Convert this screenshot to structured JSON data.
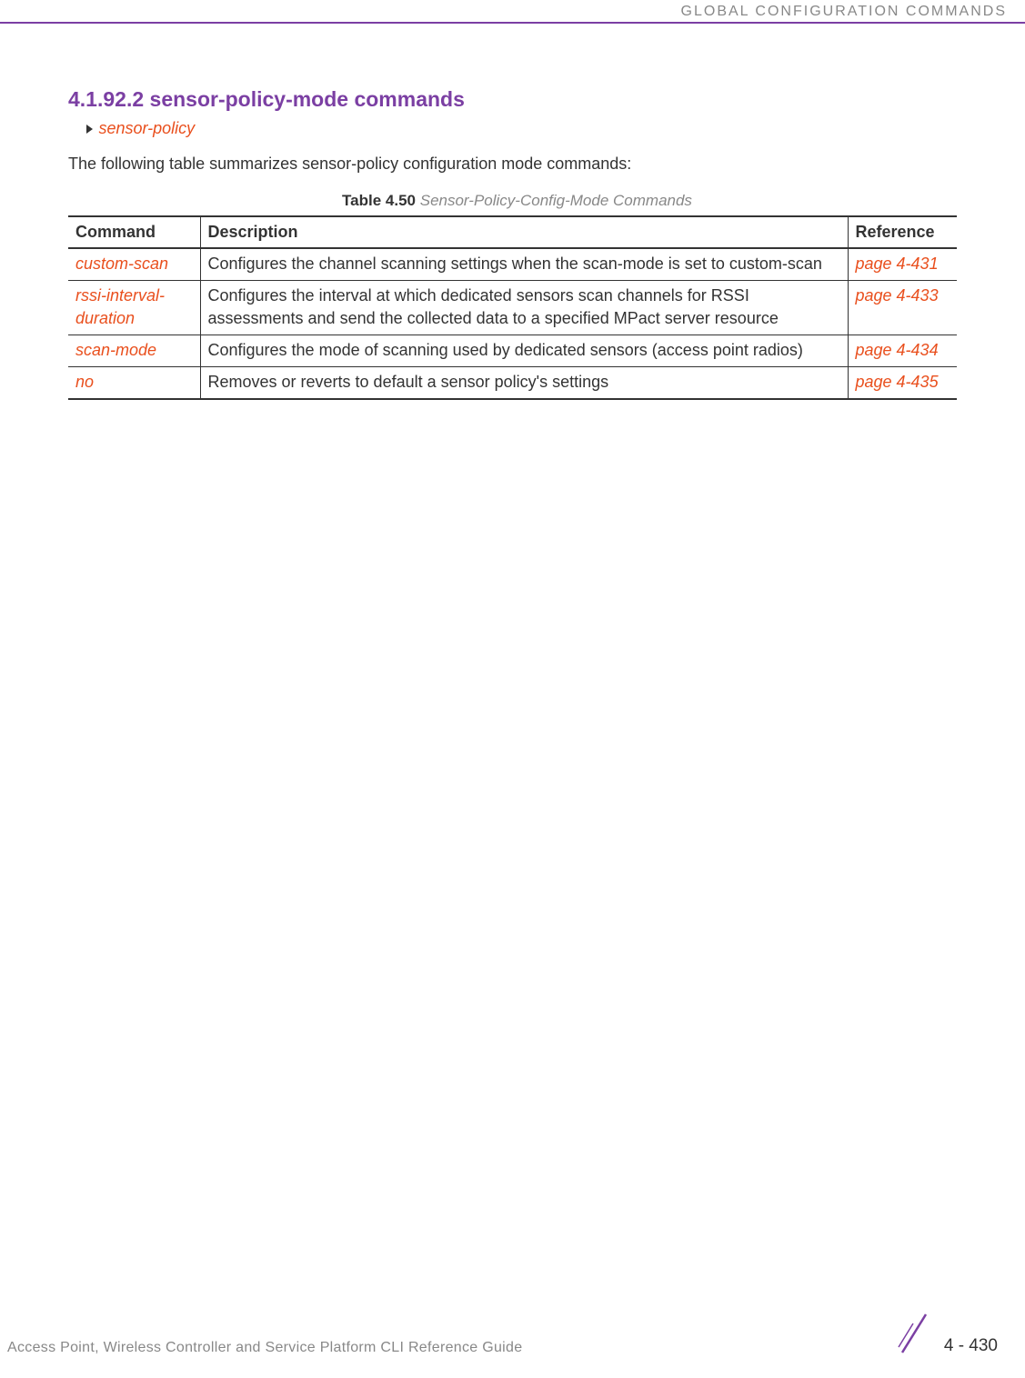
{
  "header": {
    "title": "GLOBAL CONFIGURATION COMMANDS"
  },
  "section": {
    "number": "4.1.92.2",
    "title": "sensor-policy-mode commands",
    "breadcrumb_link": "sensor-policy",
    "intro": "The following table summarizes sensor-policy configuration mode commands:"
  },
  "table": {
    "caption_prefix": "Table 4.50",
    "caption_title": " Sensor-Policy-Config-Mode Commands",
    "headers": {
      "command": "Command",
      "description": "Description",
      "reference": "Reference"
    },
    "rows": [
      {
        "command": "custom-scan",
        "description": "Configures the channel scanning settings when the scan-mode is set to custom-scan",
        "reference": "page 4-431"
      },
      {
        "command": "rssi-interval-duration",
        "description": "Configures the interval at which dedicated sensors scan channels for RSSI assessments and send the collected data to a specified MPact server resource",
        "reference": "page 4-433"
      },
      {
        "command": "scan-mode",
        "description": "Configures the mode of scanning used by dedicated sensors (access point radios)",
        "reference": "page 4-434"
      },
      {
        "command": "no",
        "description": "Removes or reverts to default a sensor policy's settings",
        "reference": "page 4-435"
      }
    ]
  },
  "footer": {
    "guide_title": "Access Point, Wireless Controller and Service Platform CLI Reference Guide",
    "page_number": "4 - 430"
  }
}
